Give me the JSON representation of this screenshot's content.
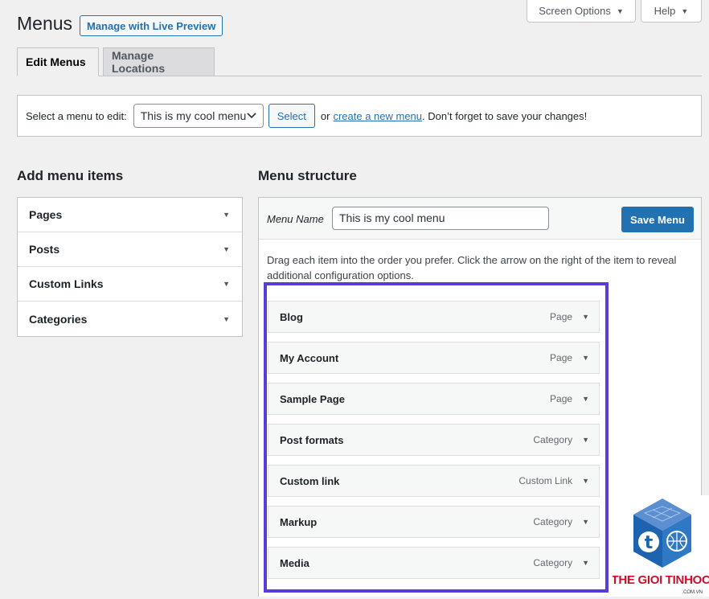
{
  "header": {
    "title": "Menus",
    "live_preview_label": "Manage with Live Preview",
    "screen_options_label": "Screen Options",
    "help_label": "Help"
  },
  "tabs": [
    {
      "label": "Edit Menus"
    },
    {
      "label": "Manage Locations"
    }
  ],
  "select_bar": {
    "prompt": "Select a menu to edit:",
    "selected_menu": "This is my cool menu",
    "select_button": "Select",
    "or_text": "or",
    "create_link": "create a new menu",
    "reminder": ". Don’t forget to save your changes!"
  },
  "add_items": {
    "heading": "Add menu items",
    "sections": [
      {
        "label": "Pages"
      },
      {
        "label": "Posts"
      },
      {
        "label": "Custom Links"
      },
      {
        "label": "Categories"
      }
    ]
  },
  "structure": {
    "heading": "Menu structure",
    "menu_name_label": "Menu Name",
    "menu_name_value": "This is my cool menu",
    "save_button": "Save Menu",
    "instructions": "Drag each item into the order you prefer. Click the arrow on the right of the item to reveal additional configuration options.",
    "items": [
      {
        "title": "Blog",
        "type": "Page"
      },
      {
        "title": "My Account",
        "type": "Page"
      },
      {
        "title": "Sample Page",
        "type": "Page"
      },
      {
        "title": "Post formats",
        "type": "Category"
      },
      {
        "title": "Custom link",
        "type": "Custom Link"
      },
      {
        "title": "Markup",
        "type": "Category"
      },
      {
        "title": "Media",
        "type": "Category"
      }
    ]
  },
  "watermark": {
    "brand": "THE GIOI TINHOC",
    "domain": ".COM.VN"
  },
  "colors": {
    "accent": "#2271b1",
    "highlight": "#5a3dd8",
    "logo_red": "#c8102e",
    "logo_blue": "#1e63b0"
  }
}
